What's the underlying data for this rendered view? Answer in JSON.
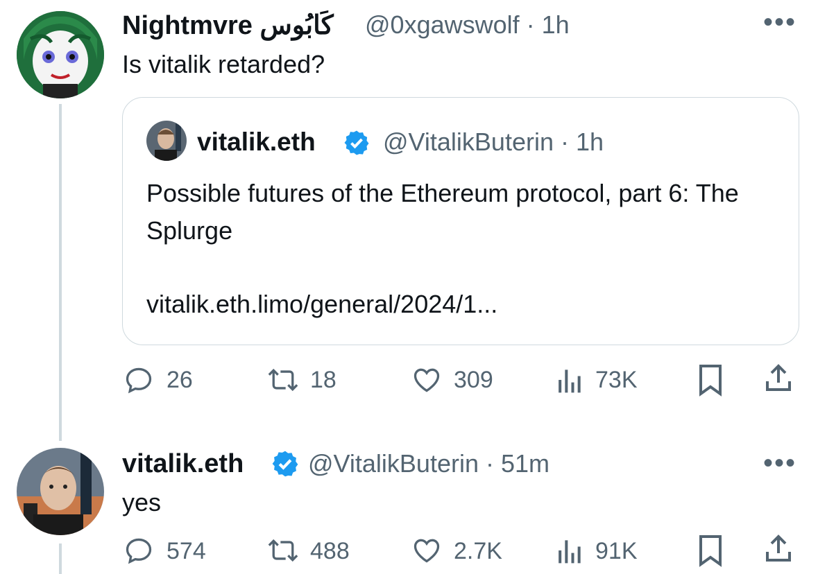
{
  "tweet1": {
    "display_name": "Nightmvre كَابُوس",
    "handle_time": "@0xgawswolf · 1h",
    "text": "Is vitalik retarded?",
    "more_icon": "ellipsis-icon",
    "quote": {
      "display_name": "vitalik.eth",
      "verified": true,
      "handle_time": "@VitalikButerin · 1h",
      "text": "Possible futures of the Ethereum protocol, part 6: The Splurge",
      "link": "vitalik.eth.limo/general/2024/1..."
    },
    "stats": {
      "replies": "26",
      "reposts": "18",
      "likes": "309",
      "views": "73K"
    }
  },
  "tweet2": {
    "display_name": "vitalik.eth",
    "verified": true,
    "handle_time": "@VitalikButerin · 51m",
    "text": "yes",
    "stats": {
      "replies": "574",
      "reposts": "488",
      "likes": "2.7K",
      "views": "91K"
    }
  },
  "colors": {
    "text_primary": "#0f1419",
    "text_secondary": "#536471",
    "verified": "#1d9bf0",
    "border": "#cfd9de"
  }
}
